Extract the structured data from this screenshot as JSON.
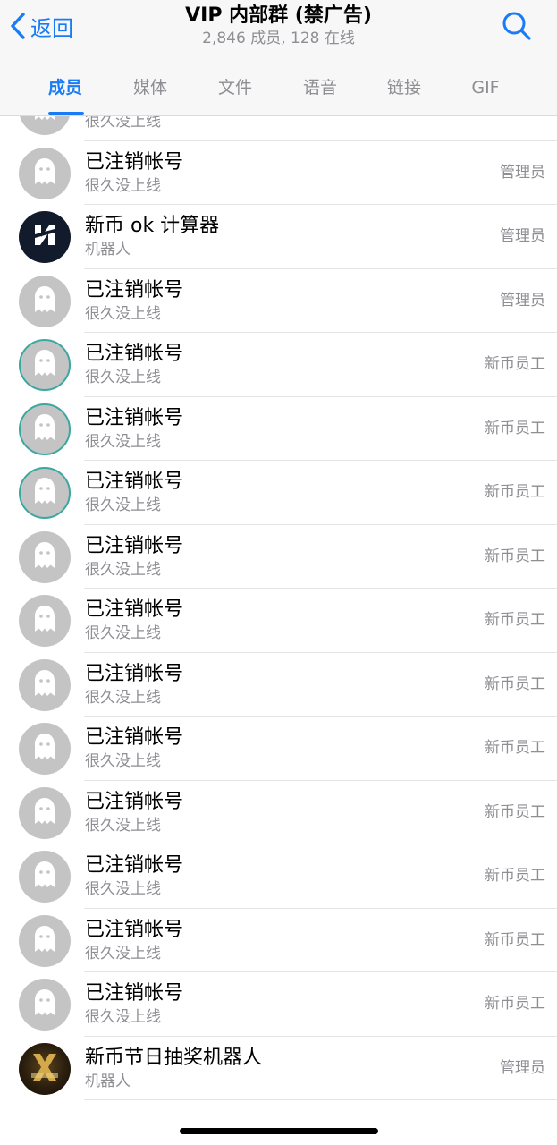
{
  "header": {
    "back_label": "返回",
    "title": "VIP 内部群 (禁广告)",
    "subtitle": "2,846 成员, 128 在线"
  },
  "tabs": [
    {
      "label": "成员",
      "active": true
    },
    {
      "label": "媒体",
      "active": false
    },
    {
      "label": "文件",
      "active": false
    },
    {
      "label": "语音",
      "active": false
    },
    {
      "label": "链接",
      "active": false
    },
    {
      "label": "GIF",
      "active": false
    }
  ],
  "members": [
    {
      "name": "",
      "status": "很久没上线",
      "role": "",
      "avatar": "ghost-icon"
    },
    {
      "name": "已注销帐号",
      "status": "很久没上线",
      "role": "管理员",
      "avatar": "ghost-icon"
    },
    {
      "name": "新币 ok 计算器",
      "status": "机器人",
      "role": "管理员",
      "avatar": "bot-logo-n"
    },
    {
      "name": "已注销帐号",
      "status": "很久没上线",
      "role": "管理员",
      "avatar": "ghost-icon"
    },
    {
      "name": "已注销帐号",
      "status": "很久没上线",
      "role": "新币员工",
      "avatar": "ghost-icon-ring"
    },
    {
      "name": "已注销帐号",
      "status": "很久没上线",
      "role": "新币员工",
      "avatar": "ghost-icon-ring"
    },
    {
      "name": "已注销帐号",
      "status": "很久没上线",
      "role": "新币员工",
      "avatar": "ghost-icon-ring"
    },
    {
      "name": "已注销帐号",
      "status": "很久没上线",
      "role": "新币员工",
      "avatar": "ghost-icon"
    },
    {
      "name": "已注销帐号",
      "status": "很久没上线",
      "role": "新币员工",
      "avatar": "ghost-icon"
    },
    {
      "name": "已注销帐号",
      "status": "很久没上线",
      "role": "新币员工",
      "avatar": "ghost-icon"
    },
    {
      "name": "已注销帐号",
      "status": "很久没上线",
      "role": "新币员工",
      "avatar": "ghost-icon"
    },
    {
      "name": "已注销帐号",
      "status": "很久没上线",
      "role": "新币员工",
      "avatar": "ghost-icon"
    },
    {
      "name": "已注销帐号",
      "status": "很久没上线",
      "role": "新币员工",
      "avatar": "ghost-icon"
    },
    {
      "name": "已注销帐号",
      "status": "很久没上线",
      "role": "新币员工",
      "avatar": "ghost-icon"
    },
    {
      "name": "已注销帐号",
      "status": "很久没上线",
      "role": "新币员工",
      "avatar": "ghost-icon"
    },
    {
      "name": "新币节日抽奖机器人",
      "status": "机器人",
      "role": "管理员",
      "avatar": "bot-logo-x"
    }
  ],
  "colors": {
    "accent": "#1a7cf5",
    "secondary_text": "#8e8e93",
    "ring": "#3aa7a0"
  }
}
